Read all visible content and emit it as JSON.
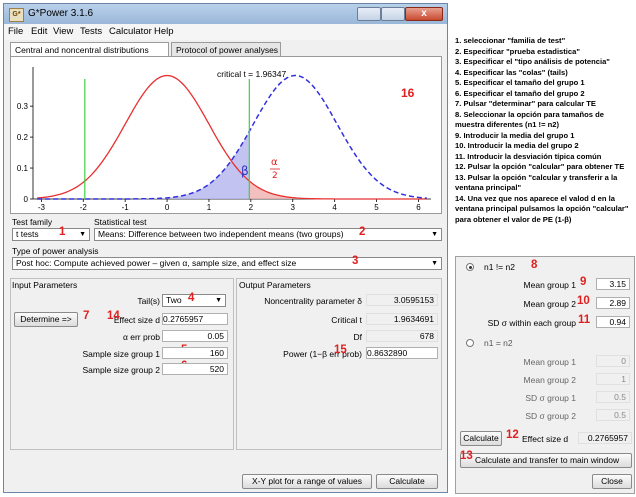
{
  "window": {
    "title": "G*Power 3.1.6",
    "icon_label": "G*",
    "close_glyph": "x",
    "menu": [
      "File",
      "Edit",
      "View",
      "Tests",
      "Calculator",
      "Help"
    ]
  },
  "tabs": [
    {
      "label": "Central and noncentral distributions",
      "active": true
    },
    {
      "label": "Protocol of power analyses",
      "active": false
    }
  ],
  "plot": {
    "critical_label": "critical t = 1.96347",
    "y_ticks": [
      "0.3",
      "0.2",
      "0.1",
      "0"
    ],
    "x_ticks": [
      "-3",
      "-2",
      "-1",
      "0",
      "1",
      "2",
      "3",
      "4",
      "5",
      "6"
    ],
    "beta_label": "β",
    "alpha_num": "α",
    "alpha_den": "2",
    "marker": "16",
    "colors": {
      "central": "#e83030",
      "noncentral": "#3030e0",
      "critical": "#40d040",
      "beta_fill": "#b8b8f0"
    }
  },
  "test_family": {
    "label": "Test family",
    "value": "t tests",
    "marker": "1"
  },
  "statistical_test": {
    "label": "Statistical test",
    "value": "Means: Difference between two independent means (two groups)",
    "marker": "2"
  },
  "power_analysis": {
    "label": "Type of power analysis",
    "value": "Post hoc: Compute achieved power – given α, sample size, and effect size",
    "marker": "3"
  },
  "input_params": {
    "title": "Input Parameters",
    "tails_label": "Tail(s)",
    "tails_value": "Two",
    "tails_marker": "4",
    "determine_label": "Determine =>",
    "determine_marker": "7",
    "effect_label": "Effect size d",
    "effect_value": "0.2765957",
    "effect_marker": "14",
    "alpha_label": "α err prob",
    "alpha_value": "0.05",
    "n1_label": "Sample size group 1",
    "n1_value": "160",
    "n1_marker": "5",
    "n2_label": "Sample size group 2",
    "n2_value": "520",
    "n2_marker": "6"
  },
  "output_params": {
    "title": "Output Parameters",
    "ncp_label": "Noncentrality parameter δ",
    "ncp_value": "3.0595153",
    "crit_label": "Critical t",
    "crit_value": "1.9634691",
    "df_label": "Df",
    "df_value": "678",
    "power_label": "Power (1−β err prob)",
    "power_value": "0.8632890",
    "power_marker": "15"
  },
  "bottom_buttons": {
    "xy_plot": "X-Y plot for a range of values",
    "calculate": "Calculate"
  },
  "instructions": [
    "1. seleccionar \"familia de test\"",
    "2. Especificar \"prueba estadistica\"",
    "3. Especificar el \"tipo análisis de potencia\"",
    "4. Especificar las \"colas\" (tails)",
    "5. Especificar el tamaño del grupo 1",
    "6. Especificar el tamaño del grupo 2",
    "7. Pulsar \"determinar\" para calcular TE",
    "8. Seleccionar la opción para tamaños de muestra diferentes (n1 != n2)",
    "9. Introducir la media del grupo 1",
    "10. Introducir la media del grupo 2",
    "11. Introducir la desviación típica común",
    "12. Pulsar la opción \"calcular\" para obtener TE",
    "13. Pulsar la opción \"calcular y transferir a la ventana principal\"",
    "14. Una vez que nos aparece el valod d en la ventana principal pulsamos la opción \"calcular\" para obtener el valor de PE (1-β)"
  ],
  "effect_panel": {
    "option1": "n1 != n2",
    "option1_marker": "8",
    "mean1_label": "Mean group 1",
    "mean1_value": "3.15",
    "mean1_marker": "9",
    "mean2_label": "Mean group 2",
    "mean2_value": "2.89",
    "mean2_marker": "10",
    "sd_label": "SD σ within each group",
    "sd_value": "0.94",
    "sd_marker": "11",
    "option2": "n1 = n2",
    "m1_label": "Mean group 1",
    "m1_value": "0",
    "m2_label": "Mean group 2",
    "m2_value": "1",
    "sd1_label": "SD σ group 1",
    "sd1_value": "0.5",
    "sd2_label": "SD σ group 2",
    "sd2_value": "0.5",
    "calculate_label": "Calculate",
    "calc_marker": "12",
    "effect_label": "Effect size d",
    "effect_value": "0.2765957",
    "transfer_label": "Calculate and transfer to main window",
    "transfer_marker": "13",
    "close_label": "Close"
  }
}
